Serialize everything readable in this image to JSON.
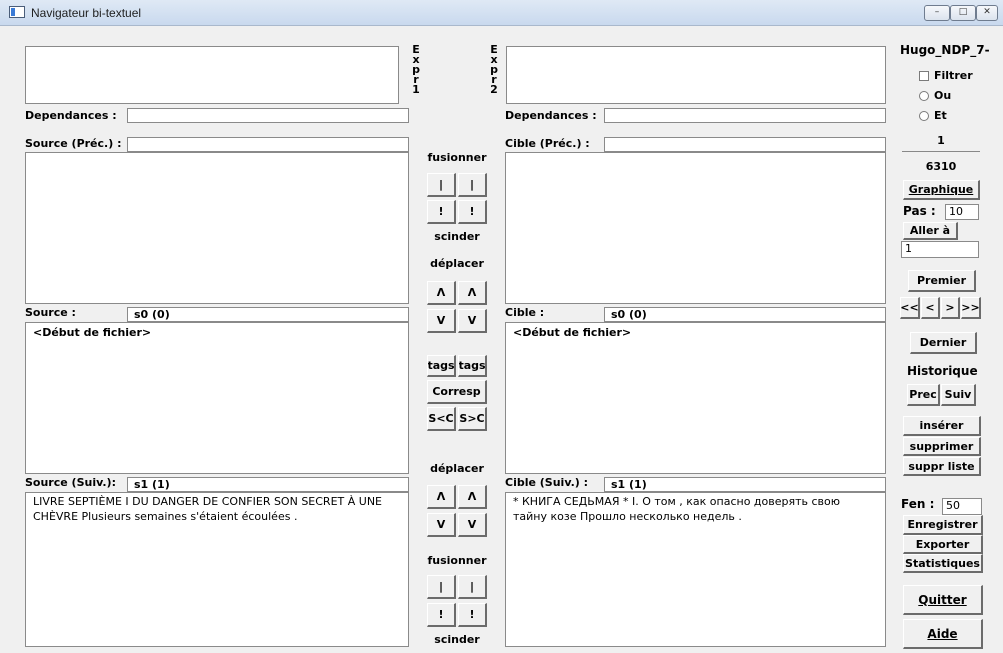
{
  "window": {
    "title": "Navigateur bi-textuel",
    "controls": {
      "minimize": "–",
      "maximize": "□",
      "close": "✕"
    }
  },
  "left": {
    "expr_label": "Expr1",
    "dependances_label": "Dependances :",
    "dependances_value": "",
    "prev_label": "Source (Préc.) :",
    "prev_value": "",
    "current_label": "Source :",
    "current_value": "s0 (0)",
    "current_text": "<Début de fichier>",
    "next_label": "Source  (Suiv.):",
    "next_value": "s1 (1)",
    "next_text": "LIVRE SEPTIÈME I DU DANGER DE CONFIER SON SECRET À UNE CHÈVRE Plusieurs semaines s'étaient écoulées ."
  },
  "right": {
    "expr_label": "Expr2",
    "dependances_label": "Dependances :",
    "dependances_value": "",
    "prev_label": "Cible (Préc.) :",
    "prev_value": "",
    "current_label": "Cible :",
    "current_value": "s0 (0)",
    "current_text": "<Début de fichier>",
    "next_label": "Cible (Suiv.) :",
    "next_value": "s1 (1)",
    "next_text": "* КНИГА СЕДЬМАЯ * I. О том , как опасно доверять свою тайну козе Прошло несколько недель ."
  },
  "middle": {
    "top_fusionner": "fusionner",
    "bar_left": "|",
    "bar_right": "|",
    "excl_left": "!",
    "excl_right": "!",
    "top_scinder": "scinder",
    "deplacer_top": "déplacer",
    "up_left": "Λ",
    "up_right": "Λ",
    "down_left": "V",
    "down_right": "V",
    "tags_left": "tags",
    "tags_right": "tags",
    "corresp": "Corresp",
    "s_lt_c": "S<C",
    "s_gt_c": "S>C",
    "deplacer_bottom": "déplacer",
    "bottom_fusionner": "fusionner",
    "bottom_scinder": "scinder"
  },
  "side": {
    "file_name": "Hugo_NDP_7-",
    "filtrer": "Filtrer",
    "ou": "Ou",
    "et": "Et",
    "current_index": "1",
    "total": "6310",
    "graphique": "Graphique",
    "pas_label": "Pas :",
    "pas_value": "10",
    "aller_a": "Aller à",
    "aller_value": "1",
    "premier": "Premier",
    "nav_first": "<<",
    "nav_prev": "<",
    "nav_next": ">",
    "nav_last": ">>",
    "dernier": "Dernier",
    "historique": "Historique",
    "prec": "Prec",
    "suiv": "Suiv",
    "inserer": "insérer",
    "supprimer": "supprimer",
    "suppr_liste": "suppr liste",
    "fen_label": "Fen :",
    "fen_value": "50",
    "enregistrer": "Enregistrer",
    "exporter": "Exporter",
    "statistiques": "Statistiques",
    "quitter": "Quitter",
    "aide": "Aide"
  }
}
